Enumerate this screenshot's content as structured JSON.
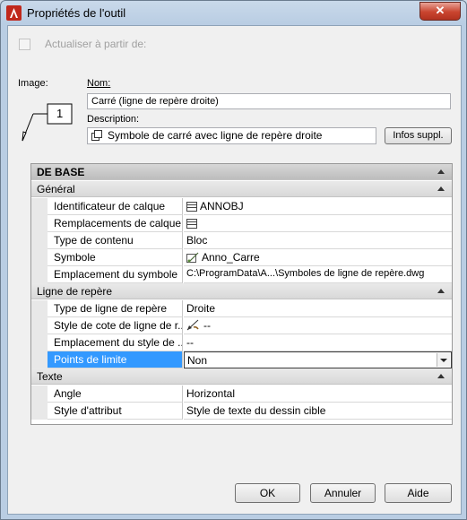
{
  "window": {
    "title": "Propriétés de l'outil",
    "close_label": "✕"
  },
  "update_checkbox": {
    "label": "Actualiser à partir de:",
    "checked": false
  },
  "image": {
    "label": "Image:",
    "preview_number": "1"
  },
  "name": {
    "label": "Nom:",
    "value": "Carré (ligne de repère droite)"
  },
  "description": {
    "label": "Description:",
    "value": "Symbole de carré avec ligne de repère droite"
  },
  "more_info_button": "Infos suppl.",
  "grid": {
    "header": "DE BASE",
    "sections": [
      {
        "title": "Général",
        "rows": [
          {
            "name": "Identificateur de calque",
            "value": "ANNOBJ",
            "icon": "layer-icon"
          },
          {
            "name": "Remplacements de calque",
            "value": "",
            "icon": "layer-icon"
          },
          {
            "name": "Type de contenu",
            "value": "Bloc"
          },
          {
            "name": "Symbole",
            "value": "Anno_Carre",
            "icon": "block-icon"
          },
          {
            "name": "Emplacement du symbole",
            "value": "C:\\ProgramData\\A...\\Symboles de ligne de repère.dwg"
          }
        ]
      },
      {
        "title": "Ligne de repère",
        "rows": [
          {
            "name": "Type de ligne de repère",
            "value": "Droite"
          },
          {
            "name": "Style de cote de ligne de r...",
            "value": "--",
            "icon": "dimstyle-icon"
          },
          {
            "name": "Emplacement du style de ...",
            "value": "--"
          },
          {
            "name": "Points de limite",
            "value": "Non",
            "selected": true
          }
        ]
      },
      {
        "title": "Texte",
        "rows": [
          {
            "name": "Angle",
            "value": "Horizontal"
          },
          {
            "name": "Style d'attribut",
            "value": "Style de texte du dessin cible"
          }
        ]
      }
    ]
  },
  "buttons": {
    "ok": "OK",
    "cancel": "Annuler",
    "help": "Aide"
  }
}
